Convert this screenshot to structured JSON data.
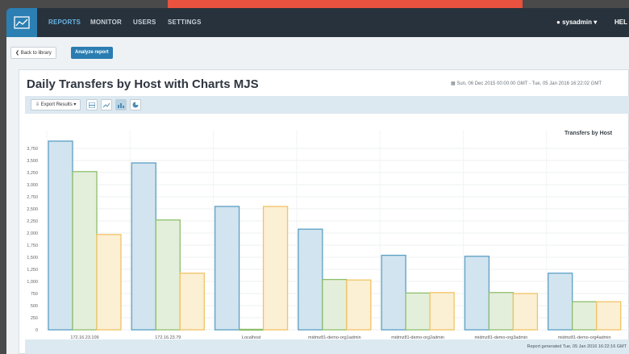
{
  "nav": {
    "items": [
      "REPORTS",
      "MONITOR",
      "USERS",
      "SETTINGS"
    ],
    "active": "REPORTS",
    "user": "sysadmin",
    "help": "HEL"
  },
  "toolbar": {
    "back_label": "Back to library",
    "analyze_label": "Analyze report"
  },
  "report": {
    "title": "Daily Transfers by Host with Charts MJS",
    "date_range": "Sun, 06 Dec 2015 00:00:00 GMT - Tue, 05 Jan 2016 16:22:02 GMT",
    "export_label": "Export Results",
    "footer": "Report generated Tue, 05 Jan 2016 16:22:16 GMT"
  },
  "colors": {
    "navbar": "#28323c",
    "accent": "#2a7db1",
    "series_blue_fill": "#d2e4ef",
    "series_blue_stroke": "#5a9fc4",
    "series_green_fill": "#e4efdb",
    "series_green_stroke": "#8cbf6a",
    "series_yellow_fill": "#fbefd4",
    "series_yellow_stroke": "#f2c365"
  },
  "chart_data": {
    "type": "bar",
    "title": "Transfers by Host",
    "categories": [
      "172.16.23.109",
      "172.16.23.79",
      "Localhost",
      "midmz81-demo-org1admin",
      "midmz81-demo-org2admin",
      "midmz81-demo-org3admin",
      "midmz81-demo-org4admin"
    ],
    "series": [
      {
        "values": [
          3900,
          3450,
          2550,
          2080,
          1540,
          1520,
          1170
        ]
      },
      {
        "values": [
          3270,
          2270,
          10,
          1040,
          760,
          770,
          580
        ]
      },
      {
        "values": [
          1970,
          1170,
          2550,
          1030,
          770,
          750,
          580
        ]
      }
    ],
    "y_ticks": [
      "0",
      "250",
      "500",
      "750",
      "1,000",
      "1,250",
      "1,500",
      "1,750",
      "2,000",
      "2,250",
      "2,500",
      "2,750",
      "3,000",
      "3,250",
      "3,500",
      "3,750"
    ],
    "ylim": [
      0,
      3900
    ],
    "grid": true
  }
}
